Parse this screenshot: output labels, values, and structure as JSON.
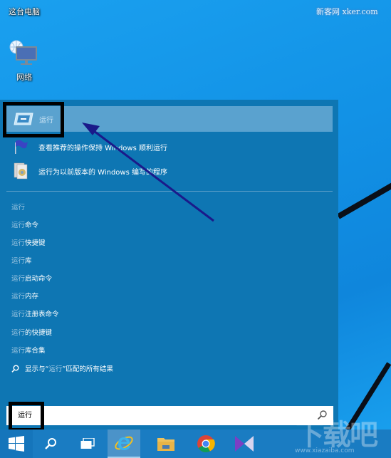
{
  "desktop": {
    "this_pc_label": "这台电脑",
    "network_label": "网络",
    "watermark_top": "新客网 xker.com",
    "watermark_bottom": "下载吧",
    "watermark_bottom_url": "www.xiazaiba.com"
  },
  "start_panel": {
    "top_result": {
      "label": "运行",
      "icon": "run-dialog-icon"
    },
    "results": [
      {
        "label": "查看推荐的操作保持 Windows 顺利运行",
        "icon": "action-center-flag-icon"
      },
      {
        "label": "运行为以前版本的 Windows 编写的程序",
        "icon": "compatibility-troubleshooter-icon"
      }
    ],
    "suggestions": [
      {
        "prefix": "运行",
        "suffix": ""
      },
      {
        "prefix": "运行",
        "suffix": "命令"
      },
      {
        "prefix": "运行",
        "suffix": "快捷键"
      },
      {
        "prefix": "运行",
        "suffix": "库"
      },
      {
        "prefix": "运行",
        "suffix": "启动命令"
      },
      {
        "prefix": "运行",
        "suffix": "内存"
      },
      {
        "prefix": "运行",
        "suffix": "注册表命令"
      },
      {
        "prefix": "运行",
        "suffix": "的快捷键"
      },
      {
        "prefix": "运行",
        "suffix": "库合集"
      }
    ],
    "all_results": {
      "before": "显示与“",
      "term": "运行",
      "after": "”匹配的所有结果"
    },
    "search_box": {
      "value": "运行"
    }
  },
  "taskbar": {
    "items": [
      "start-button",
      "search-button",
      "task-view-button",
      "internet-explorer",
      "file-explorer",
      "chrome",
      "visual-studio"
    ]
  },
  "colors": {
    "desktop": "#1292e6",
    "panel": "#0e76b3",
    "top_result_highlight": "#5aa2cf",
    "taskbar": "#1a7cc2",
    "annotation_arrow": "#1a1a8a"
  }
}
